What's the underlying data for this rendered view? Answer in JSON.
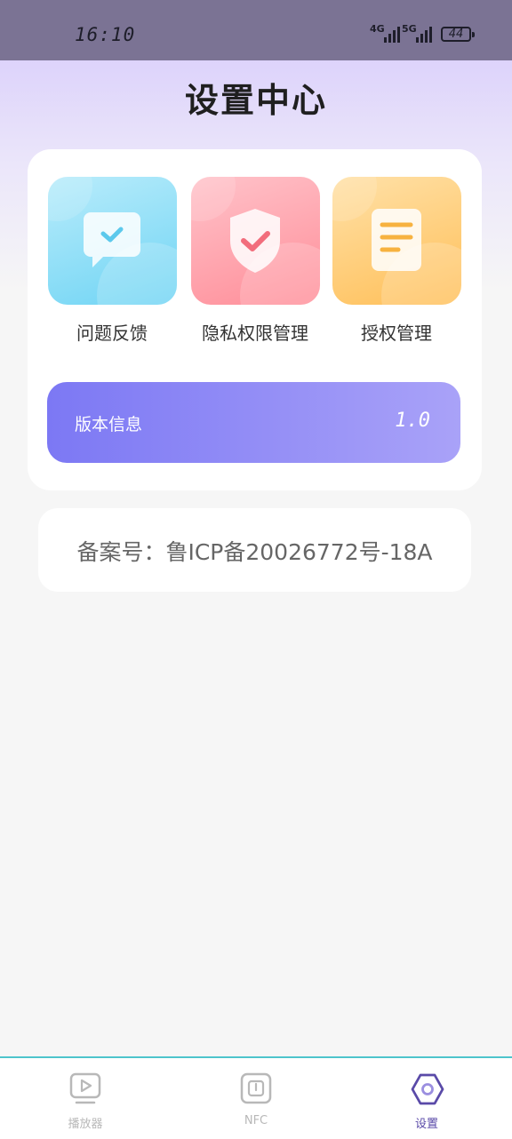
{
  "status_bar": {
    "time": "16:10",
    "signal_1": "4G",
    "signal_2": "5G",
    "battery": "44"
  },
  "page": {
    "title": "设置中心"
  },
  "shortcuts": [
    {
      "label": "问题反馈",
      "icon": "feedback-chat-icon",
      "color": "#6fd4f4"
    },
    {
      "label": "隐私权限管理",
      "icon": "privacy-shield-icon",
      "color": "#ff8d98"
    },
    {
      "label": "授权管理",
      "icon": "document-icon",
      "color": "#ffbf58"
    }
  ],
  "version": {
    "label": "版本信息",
    "value": "1.0"
  },
  "icp": {
    "text": "备案号：鲁ICP备20026772号-18A"
  },
  "tabbar": {
    "active_color": "#5a4aa8",
    "inactive_color": "#b8b8b8",
    "tabs": [
      {
        "label": "播放器",
        "icon": "player-icon",
        "active": false
      },
      {
        "label": "NFC",
        "icon": "nfc-icon",
        "active": false
      },
      {
        "label": "设置",
        "icon": "settings-hexagon-icon",
        "active": true
      }
    ]
  }
}
